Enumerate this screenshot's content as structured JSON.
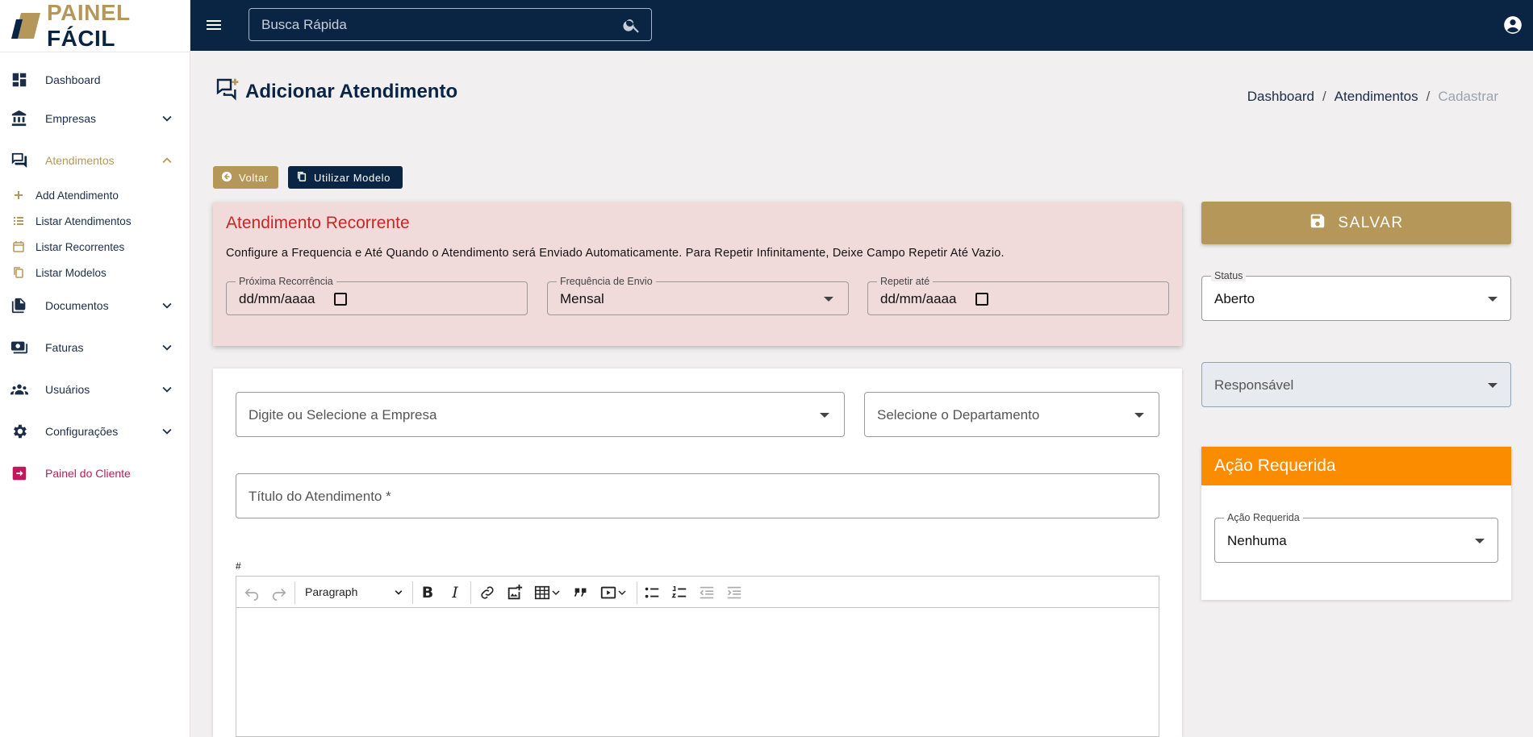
{
  "brand": {
    "part1": "PAINEL",
    "part2": "FÁCIL",
    "gold": "#b5975a",
    "navy": "#0a2444"
  },
  "sidebar": {
    "items": [
      {
        "label": "Dashboard",
        "icon": "dashboard-icon"
      },
      {
        "label": "Empresas",
        "icon": "bank-icon"
      },
      {
        "label": "Atendimentos",
        "icon": "forum-icon"
      },
      {
        "label": "Documentos",
        "icon": "documents-icon"
      },
      {
        "label": "Faturas",
        "icon": "payments-icon"
      },
      {
        "label": "Usuários",
        "icon": "users-icon"
      },
      {
        "label": "Configurações",
        "icon": "gear-icon"
      },
      {
        "label": "Painel do Cliente",
        "icon": "exit-icon"
      }
    ],
    "sub_items": [
      {
        "label": "Add Atendimento",
        "icon": "plus-icon"
      },
      {
        "label": "Listar Atendimentos",
        "icon": "list-icon"
      },
      {
        "label": "Listar Recorrentes",
        "icon": "calendar-icon"
      },
      {
        "label": "Listar Modelos",
        "icon": "copy-icon"
      }
    ],
    "active_color": "#b5975a",
    "danger_color": "#c2185b"
  },
  "topbar": {
    "search_placeholder": "Busca Rápida"
  },
  "page": {
    "title": "Adicionar Atendimento",
    "breadcrumb": [
      "Dashboard",
      "Atendimentos",
      "Cadastrar"
    ],
    "breadcrumb_sep": "/",
    "back_label": "Voltar",
    "template_label": "Utilizar Modelo"
  },
  "recurring": {
    "title": "Atendimento Recorrente",
    "description": "Configure a Frequencia e Até Quando o Atendimento será Enviado Automaticamente. Para Repetir Infinitamente, Deixe Campo Repetir Até Vazio.",
    "next_label": "Próxima Recorrência",
    "next_value": "dd/mm/aaaa",
    "freq_label": "Frequência de Envio",
    "freq_value": "Mensal",
    "until_label": "Repetir até",
    "until_value": "dd/mm/aaaa"
  },
  "form": {
    "company_placeholder": "Digite ou Selecione a Empresa",
    "department_placeholder": "Selecione o Departamento",
    "title_placeholder": "Título do Atendimento *",
    "editor_hash": "#",
    "paragraph_label": "Paragraph"
  },
  "side": {
    "save_label": "SALVAR",
    "status_label": "Status",
    "status_value": "Aberto",
    "responsible_placeholder": "Responsável",
    "action_title": "Ação Requerida",
    "action_field_label": "Ação Requerida",
    "action_value": "Nenhuma",
    "orange": "#fb8c00"
  }
}
